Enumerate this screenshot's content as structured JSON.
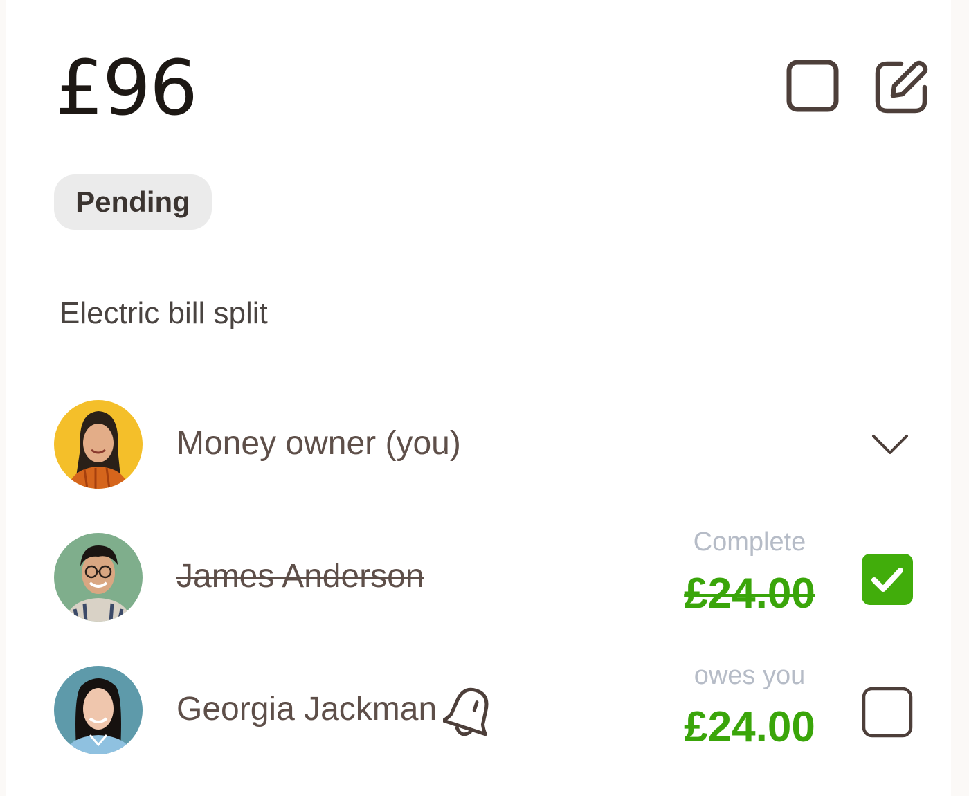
{
  "expense": {
    "amount": "£96",
    "status_badge": "Pending",
    "description": "Electric bill split"
  },
  "header_actions": [
    {
      "icon": "square-outline-icon"
    },
    {
      "icon": "edit-pencil-icon"
    }
  ],
  "participants": [
    {
      "name": "Money owner (you)",
      "icon": "chevron-down-icon"
    },
    {
      "name": "James Anderson",
      "status": "Complete",
      "amount": "£24.00",
      "paid": true
    },
    {
      "name": "Georgia Jackman",
      "status": "owes you",
      "amount": "£24.00",
      "paid": false,
      "icon": "bell-icon"
    }
  ],
  "colors": {
    "amount_green": "#3aa50a",
    "check_green": "#41ad0b",
    "icon_brown": "#4d3f3a",
    "status_gray": "#b6bcc7",
    "badge_bg": "#ebebeb"
  }
}
